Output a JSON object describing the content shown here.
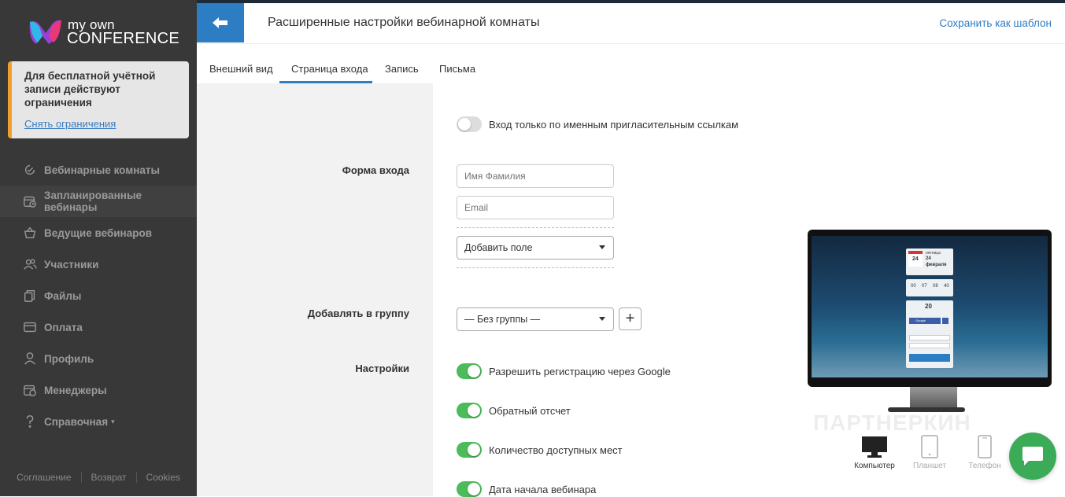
{
  "app": {
    "logo_top": "my own",
    "logo_bottom": "CONFERENCE"
  },
  "notice": {
    "text": "Для бесплатной учётной записи действуют ограничения",
    "link": "Снять ограничения"
  },
  "sidebar": {
    "items": [
      {
        "label": "Вебинарные комнаты",
        "icon": "webinar-rooms-icon"
      },
      {
        "label": "Запланированные вебинары",
        "icon": "calendar-clock-icon"
      },
      {
        "label": "Ведущие вебинаров",
        "icon": "presenter-icon"
      },
      {
        "label": "Участники",
        "icon": "users-icon"
      },
      {
        "label": "Файлы",
        "icon": "files-icon"
      },
      {
        "label": "Оплата",
        "icon": "credit-card-icon"
      },
      {
        "label": "Профиль",
        "icon": "user-icon"
      },
      {
        "label": "Менеджеры",
        "icon": "managers-icon"
      },
      {
        "label": "Справочная",
        "icon": "question-icon"
      }
    ],
    "footer": [
      "Соглашение",
      "Возврат",
      "Cookies"
    ]
  },
  "header": {
    "title": "Расширенные настройки вебинарной комнаты",
    "save_template": "Сохранить как шаблон"
  },
  "tabs": [
    "Внешний вид",
    "Страница входа",
    "Запись",
    "Письма"
  ],
  "active_tab": "Страница входа",
  "form": {
    "invite_only_label": "Вход только по именным пригласительным ссылкам",
    "login_form_label": "Форма входа",
    "name_placeholder": "Имя Фамилия",
    "email_placeholder": "Email",
    "add_field": "Добавить поле",
    "group_label": "Добавлять в группу",
    "group_value": "— Без группы —",
    "settings_label": "Настройки",
    "settings": [
      {
        "label": "Разрешить регистрацию через Google",
        "on": true
      },
      {
        "label": "Обратный отсчет",
        "on": true
      },
      {
        "label": "Количество доступных мест",
        "on": true
      },
      {
        "label": "Дата начала вебинара",
        "on": true
      }
    ]
  },
  "preview": {
    "weekday": "пятница",
    "day": "24",
    "month": "февраля",
    "countdown": [
      "00",
      "07",
      "08",
      "40"
    ],
    "seats": "20",
    "social": "Google",
    "devices": [
      "Компьютер",
      "Планшет",
      "Телефон"
    ]
  },
  "watermark": "ПАРТНЕРКИН",
  "colors": {
    "accent": "#2c7dc3",
    "toggle_on": "#4cbb5a",
    "sidebar_bg": "#383838",
    "chat": "#3cab58"
  }
}
